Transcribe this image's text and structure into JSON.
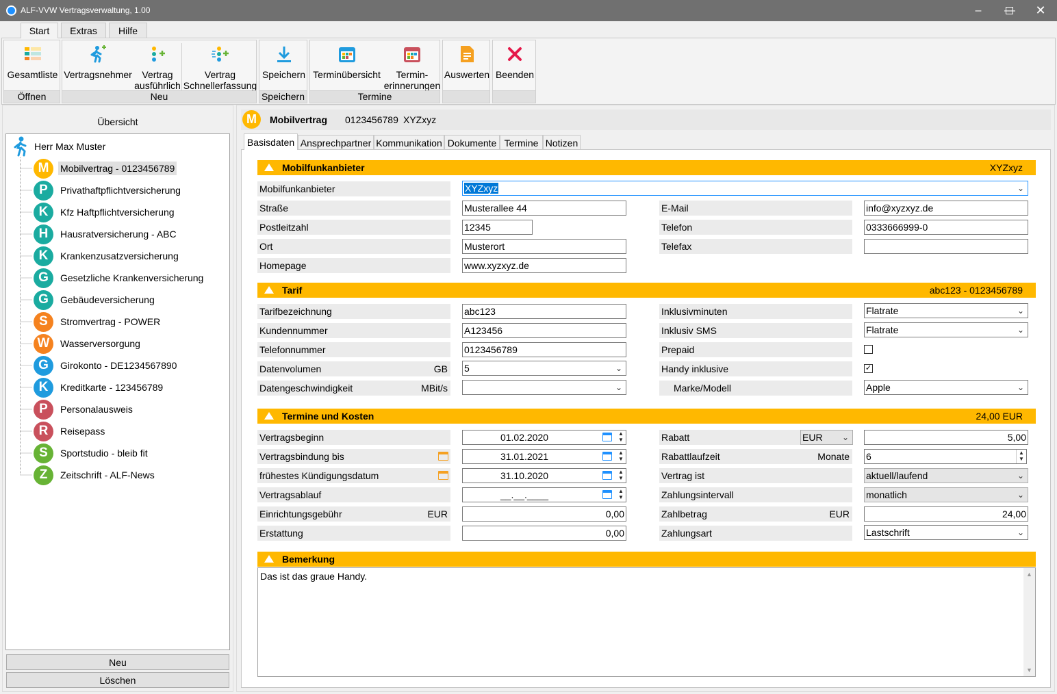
{
  "window": {
    "title": "ALF-VVW Vertragsverwaltung, 1.00"
  },
  "ribbon": {
    "tabs": [
      "Start",
      "Extras",
      "Hilfe"
    ],
    "buttons": {
      "gesamtliste": "Gesamtliste",
      "vertragsnehmer": "Vertragsnehmer",
      "vertrag_ausf_1": "Vertrag",
      "vertrag_ausf_2": "ausführlich",
      "vertrag_schnell_1": "Vertrag",
      "vertrag_schnell_2": "Schnellerfassung",
      "speichern": "Speichern",
      "terminuebersicht": "Terminübersicht",
      "termin_erinn_1": "Termin-",
      "termin_erinn_2": "erinnerungen",
      "auswerten": "Auswerten",
      "beenden": "Beenden"
    },
    "groups": {
      "oeffnen": "Öffnen",
      "neu": "Neu",
      "speichern": "Speichern",
      "termine": "Termine"
    }
  },
  "sidebar": {
    "title": "Übersicht",
    "root": "Herr Max Muster",
    "items": [
      {
        "letter": "M",
        "label": "Mobilvertrag - 0123456789",
        "color": "#ffb800"
      },
      {
        "letter": "P",
        "label": "Privathaftpflichtversicherung",
        "color": "#1aaba0"
      },
      {
        "letter": "K",
        "label": "Kfz Haftpflichtversicherung",
        "color": "#1aaba0"
      },
      {
        "letter": "H",
        "label": "Hausratversicherung - ABC",
        "color": "#1aaba0"
      },
      {
        "letter": "K",
        "label": "Krankenzusatzversicherung",
        "color": "#1aaba0"
      },
      {
        "letter": "G",
        "label": "Gesetzliche Krankenversicherung",
        "color": "#1aaba0"
      },
      {
        "letter": "G",
        "label": "Gebäudeversicherung",
        "color": "#1aaba0"
      },
      {
        "letter": "S",
        "label": "Stromvertrag - POWER",
        "color": "#f5821f"
      },
      {
        "letter": "W",
        "label": "Wasserversorgung",
        "color": "#f5821f"
      },
      {
        "letter": "G",
        "label": "Girokonto - DE1234567890",
        "color": "#1f9bde"
      },
      {
        "letter": "K",
        "label": "Kreditkarte - 123456789",
        "color": "#1f9bde"
      },
      {
        "letter": "P",
        "label": "Personalausweis",
        "color": "#c9505c"
      },
      {
        "letter": "R",
        "label": "Reisepass",
        "color": "#c9505c"
      },
      {
        "letter": "S",
        "label": "Sportstudio - bleib fit",
        "color": "#67b335"
      },
      {
        "letter": "Z",
        "label": "Zeitschrift - ALF-News",
        "color": "#67b335"
      }
    ],
    "new_button": "Neu",
    "delete_button": "Löschen"
  },
  "header": {
    "badge": "M",
    "type": "Mobilvertrag",
    "number": "0123456789",
    "provider": "XYZxyz"
  },
  "detail_tabs": [
    "Basisdaten",
    "Ansprechpartner",
    "Kommunikation",
    "Dokumente",
    "Termine",
    "Notizen"
  ],
  "sections": {
    "mobilfunk": {
      "title": "Mobilfunkanbieter",
      "value": "XYZxyz"
    },
    "tarif": {
      "title": "Tarif",
      "value": "abc123 - 0123456789"
    },
    "termine": {
      "title": "Termine und Kosten",
      "value": "24,00 EUR"
    },
    "bemerkung": {
      "title": "Bemerkung"
    }
  },
  "fields": {
    "mobilfunkanbieter": {
      "label": "Mobilfunkanbieter",
      "value": "XYZxyz"
    },
    "strasse": {
      "label": "Straße",
      "value": "Musterallee 44"
    },
    "plz": {
      "label": "Postleitzahl",
      "value": "12345"
    },
    "ort": {
      "label": "Ort",
      "value": "Musterort"
    },
    "homepage": {
      "label": "Homepage",
      "value": "www.xyzxyz.de"
    },
    "email": {
      "label": "E-Mail",
      "value": "info@xyzxyz.de"
    },
    "telefon": {
      "label": "Telefon",
      "value": "0333666999-0"
    },
    "telefax": {
      "label": "Telefax",
      "value": ""
    },
    "tarifbezeichnung": {
      "label": "Tarifbezeichnung",
      "value": "abc123"
    },
    "kundennummer": {
      "label": "Kundennummer",
      "value": "A123456"
    },
    "telefonnummer": {
      "label": "Telefonnummer",
      "value": "0123456789"
    },
    "datenvolumen": {
      "label": "Datenvolumen",
      "unit": "GB",
      "value": "5"
    },
    "datengeschwindigkeit": {
      "label": "Datengeschwindigkeit",
      "unit": "MBit/s",
      "value": ""
    },
    "inklusivminuten": {
      "label": "Inklusivminuten",
      "value": "Flatrate"
    },
    "inklusiv_sms": {
      "label": "Inklusiv SMS",
      "value": "Flatrate"
    },
    "prepaid": {
      "label": "Prepaid",
      "checked": ""
    },
    "handy_inklusive": {
      "label": "Handy inklusive",
      "checked": "✓"
    },
    "marke_modell": {
      "label": "Marke/Modell",
      "value": "Apple"
    },
    "vertragsbeginn": {
      "label": "Vertragsbeginn",
      "value": "01.02.2020"
    },
    "vertragsbindung": {
      "label": "Vertragsbindung bis",
      "value": "31.01.2021"
    },
    "kuendigung": {
      "label": "frühestes Kündigungsdatum",
      "value": "31.10.2020"
    },
    "vertragsablauf": {
      "label": "Vertragsablauf",
      "value": "__.__.____"
    },
    "einrichtung": {
      "label": "Einrichtungsgebühr",
      "unit": "EUR",
      "value": "0,00"
    },
    "erstattung": {
      "label": "Erstattung",
      "value": "0,00"
    },
    "rabatt": {
      "label": "Rabatt",
      "currency": "EUR",
      "value": "5,00"
    },
    "rabattlaufzeit": {
      "label": "Rabattlaufzeit",
      "unit": "Monate",
      "value": "6"
    },
    "vertrag_ist": {
      "label": "Vertrag ist",
      "value": "aktuell/laufend"
    },
    "zahlungsintervall": {
      "label": "Zahlungsintervall",
      "value": "monatlich"
    },
    "zahlbetrag": {
      "label": "Zahlbetrag",
      "unit": "EUR",
      "value": "24,00"
    },
    "zahlungsart": {
      "label": "Zahlungsart",
      "value": "Lastschrift"
    }
  },
  "remark": {
    "text": "Das ist das graue Handy."
  }
}
